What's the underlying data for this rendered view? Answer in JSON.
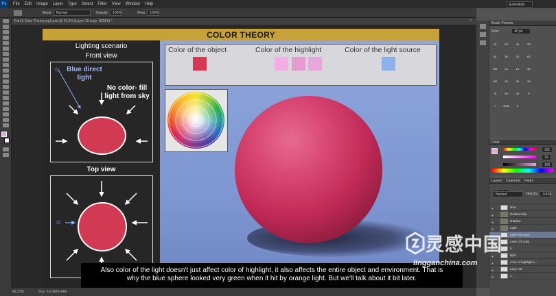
{
  "app": {
    "logo": "Ps",
    "menu": [
      "File",
      "Edit",
      "Image",
      "Layer",
      "Type",
      "Select",
      "Filter",
      "View",
      "Window",
      "Help"
    ],
    "workspace": "Essentials"
  },
  "options_bar": {
    "mode_label": "Mode:",
    "mode_value": "Normal",
    "opacity_label": "Opacity:",
    "opacity_value": "100%",
    "flow_label": "Flow:",
    "flow_value": "100%"
  },
  "document_tab": {
    "title": "Part 5 Color Theory.mp1.psd @ 42.2% (Layer 19 copy, RGB/8) *"
  },
  "artboard": {
    "title": "COLOR THEORY",
    "left": {
      "heading": "Lighting scenario",
      "front_view_label": "Front view",
      "blue_light_label": "Blue direct light",
      "fill_light_label": "No color- fill light from sky",
      "top_view_label": "Top view"
    },
    "swatches": {
      "object_label": "Color of the object",
      "highlight_label": "Color of the highlight",
      "light_source_label": "Color of the light source",
      "object_color": "#d63a53",
      "highlight_colors": [
        "#f3aee6",
        "#e79ad0",
        "#e7a6dc"
      ],
      "light_source_color": "#8cb0ec"
    }
  },
  "panels": {
    "brush_presets_tab": "Brush Presets",
    "size_label": "Size:",
    "size_value": "45 px",
    "brush_sizes": [
      "20",
      "28",
      "40",
      "25",
      "40",
      "30",
      "20",
      "60",
      "100",
      "24",
      "10",
      "36",
      "192",
      "25",
      "40",
      "36",
      "70",
      "39",
      "78",
      "9",
      "7",
      "1000",
      "5"
    ],
    "color_tab": "Color",
    "color_h": "301",
    "color_s": "19",
    "color_b": "100",
    "layers_tabs": [
      "Layers",
      "Channels",
      "Paths"
    ],
    "blend_mode": "Normal",
    "opacity_label": "Opacity:",
    "opacity_value": "100%",
    "layers": [
      "lines",
      "Relationship",
      "shadow",
      "Light",
      "Layer 19 copy",
      "Layer 19 copy",
      "b",
      "light",
      "color of highlight s...",
      "Layer 18",
      "1"
    ]
  },
  "status_bar": {
    "zoom": "42.21%",
    "doc_info": "Doc: 10.0M/9.54M"
  },
  "subtitle": {
    "line1": "Also color of the light doesn't just affect color of highlight, it also affects the entire object and environment. That is",
    "line2": "why the blue sphere looked very green when it hit by orange light. But we'll talk about it bit later."
  },
  "watermark": {
    "main": "灵感中国",
    "sub": "lingganchina.com"
  }
}
